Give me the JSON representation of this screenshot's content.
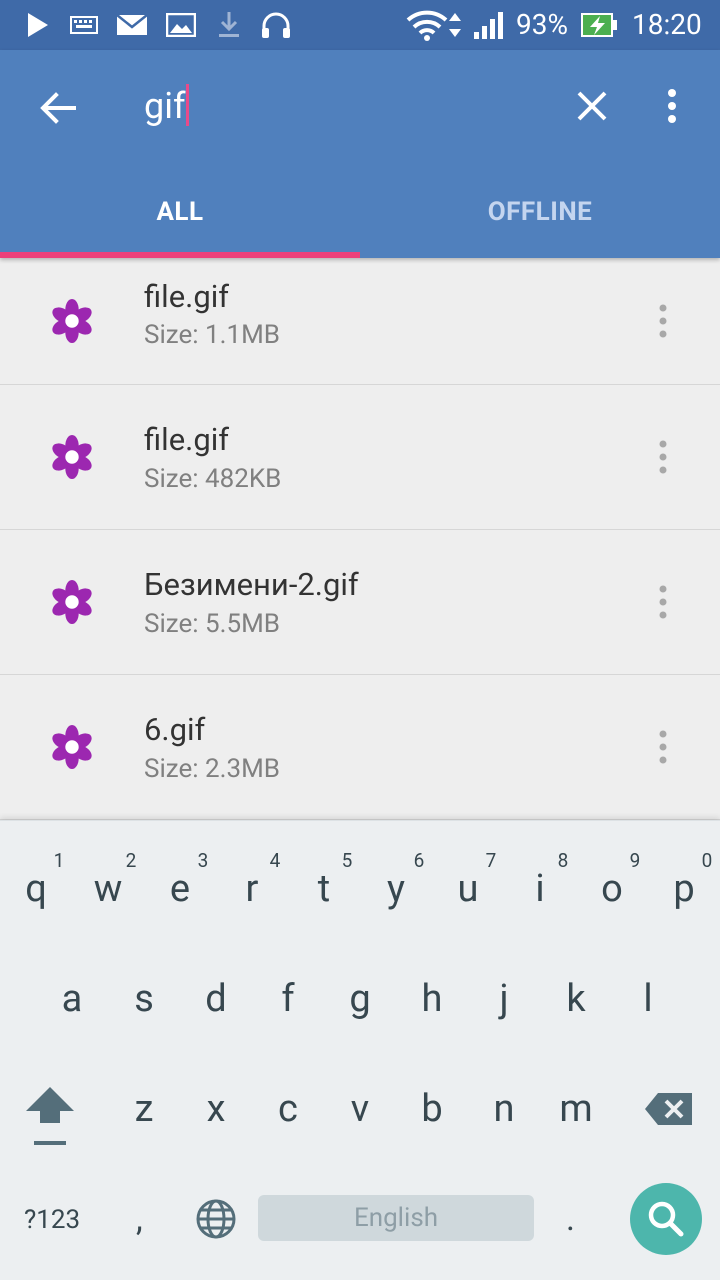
{
  "status_bar": {
    "battery": "93%",
    "time": "18:20"
  },
  "app_bar": {
    "search_query": "gif",
    "tabs": [
      {
        "label": "ALL"
      },
      {
        "label": "OFFLINE"
      }
    ]
  },
  "files": [
    {
      "name": "file.gif",
      "size": "Size: 1.1MB"
    },
    {
      "name": "file.gif",
      "size": "Size: 482KB"
    },
    {
      "name": "Безимени-2.gif",
      "size": "Size: 5.5MB"
    },
    {
      "name": "6.gif",
      "size": "Size: 2.3MB"
    }
  ],
  "keyboard": {
    "row1": [
      "q",
      "w",
      "e",
      "r",
      "t",
      "y",
      "u",
      "i",
      "o",
      "p"
    ],
    "row1_hints": [
      "1",
      "2",
      "3",
      "4",
      "5",
      "6",
      "7",
      "8",
      "9",
      "0"
    ],
    "row2": [
      "a",
      "s",
      "d",
      "f",
      "g",
      "h",
      "j",
      "k",
      "l"
    ],
    "row3": [
      "z",
      "x",
      "c",
      "v",
      "b",
      "n",
      "m"
    ],
    "symbols_label": "?123",
    "comma": ",",
    "period": ".",
    "space_label": "English"
  },
  "colors": {
    "app_bar": "#5080bd",
    "status_bar": "#3f6aa8",
    "tab_indicator": "#ec407a",
    "file_icon": "#9c27b0",
    "search_key": "#4db6ac"
  }
}
